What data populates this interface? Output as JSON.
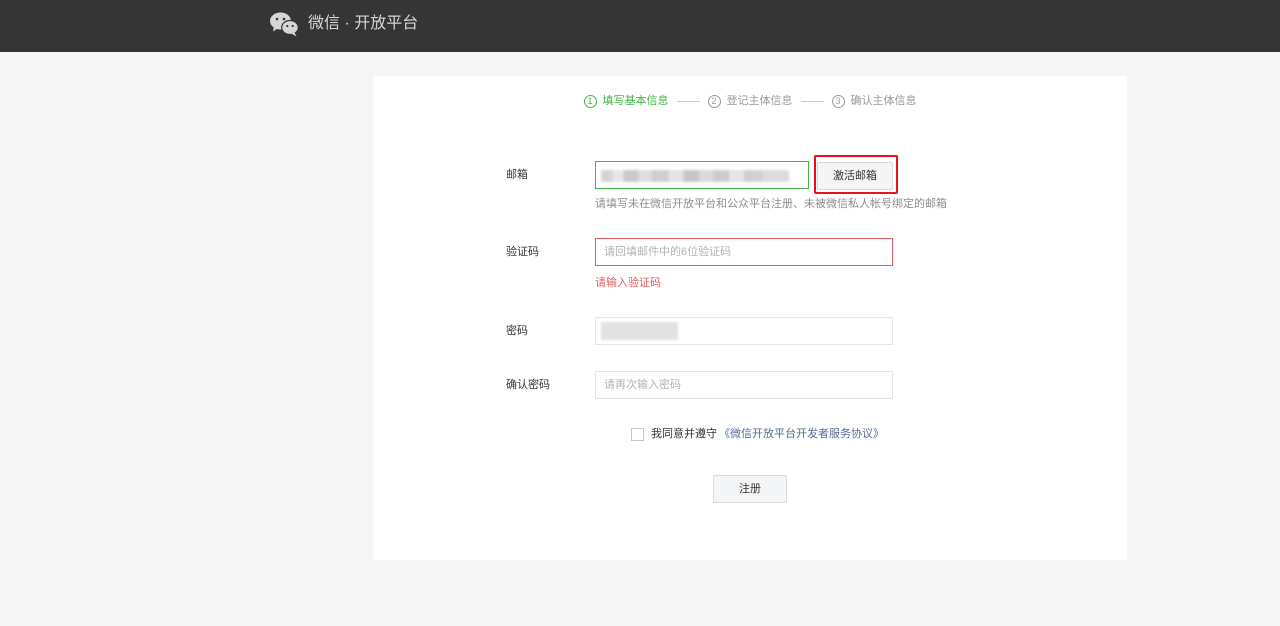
{
  "header": {
    "logo_icon": "wechat-logo-icon",
    "brand_title": "微信 · 开放平台"
  },
  "steps": [
    {
      "number": "1",
      "label": "填写基本信息",
      "active": true
    },
    {
      "number": "2",
      "label": "登记主体信息",
      "active": false
    },
    {
      "number": "3",
      "label": "确认主体信息",
      "active": false
    }
  ],
  "form": {
    "email": {
      "label": "邮箱",
      "activate_button_label": "激活邮箱",
      "hint": "请填写未在微信开放平台和公众平台注册、未被微信私人帐号绑定的邮箱"
    },
    "verify_code": {
      "label": "验证码",
      "placeholder": "请回填邮件中的6位验证码",
      "error": "请输入验证码"
    },
    "password": {
      "label": "密码"
    },
    "confirm_password": {
      "label": "确认密码",
      "placeholder": "请再次输入密码"
    },
    "agreement": {
      "checked": false,
      "text": "我同意并遵守",
      "link_text": "《微信开放平台开发者服务协议》"
    },
    "submit_label": "注册"
  },
  "colors": {
    "accent": "#44b549",
    "error": "#e15f63",
    "link": "#576b95",
    "header_bg": "#353535",
    "page_bg": "#f6f6f6",
    "card_bg": "#ffffff"
  }
}
